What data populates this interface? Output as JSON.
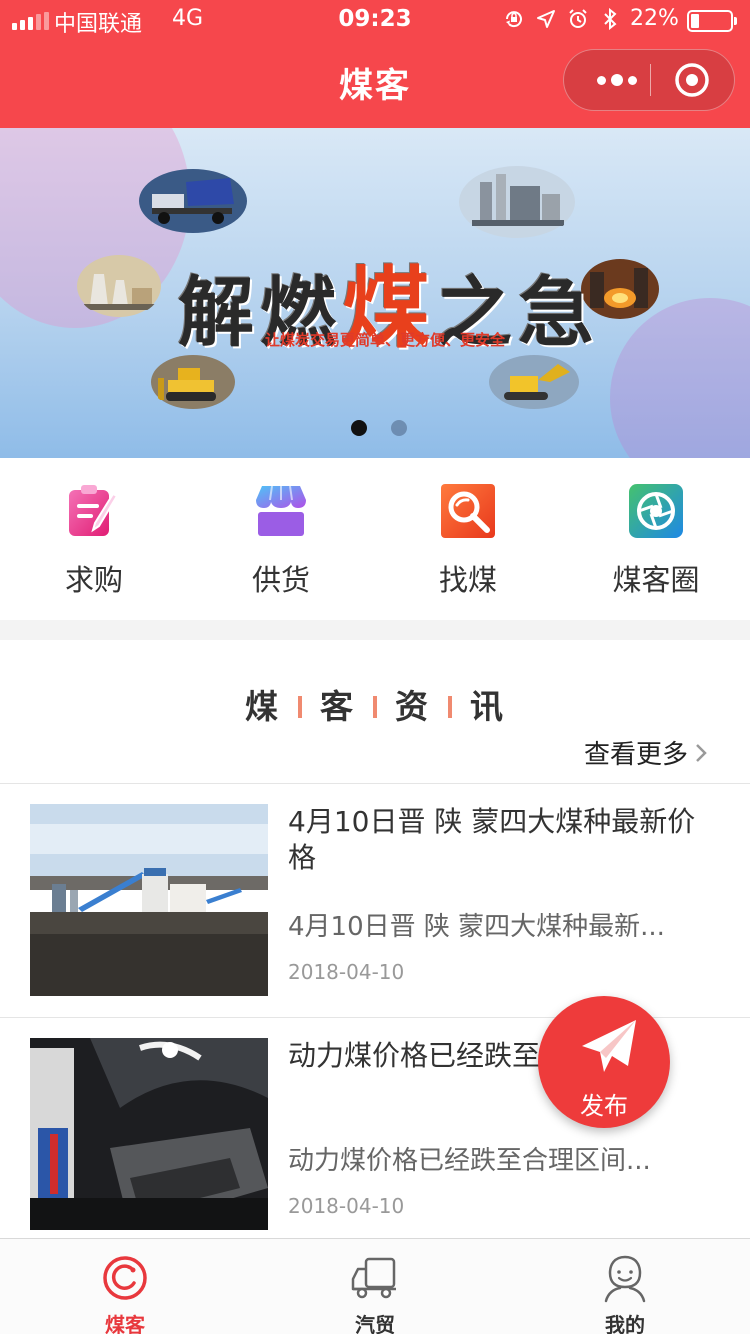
{
  "status_bar": {
    "carrier": "中国联通",
    "network": "4G",
    "time": "09:23",
    "battery_percent": "22%",
    "battery_level": 0.22,
    "icons": [
      "orientation-lock-icon",
      "location-icon",
      "alarm-icon",
      "bluetooth-icon"
    ]
  },
  "nav": {
    "title": "煤客",
    "more_icon": "more-dots-icon",
    "close_icon": "target-close-icon",
    "color": "#f6474c"
  },
  "banner": {
    "headline_part1": "解燃",
    "headline_hot": "煤",
    "headline_part2": "之急",
    "subline": "让煤炭交易更简单、更方便、更安全",
    "slides": 2,
    "active_slide": 1
  },
  "quick_menu": [
    {
      "label": "求购",
      "icon": "purchase-request-icon"
    },
    {
      "label": "供货",
      "icon": "supply-store-icon"
    },
    {
      "label": "找煤",
      "icon": "search-coal-icon"
    },
    {
      "label": "煤客圈",
      "icon": "community-circle-icon"
    }
  ],
  "news": {
    "title_chars": [
      "煤",
      "客",
      "资",
      "讯"
    ],
    "more_label": "查看更多",
    "articles": [
      {
        "title": "4月10日晋 陕 蒙四大煤种最新价格",
        "description": "4月10日晋 陕 蒙四大煤种最新...",
        "date": "2018-04-10"
      },
      {
        "title": "动力煤价格已经跌至合理区间",
        "description": "动力煤价格已经跌至合理区间...",
        "date": "2018-04-10"
      }
    ]
  },
  "fab": {
    "label": "发布",
    "icon": "paper-plane-icon"
  },
  "tabs": [
    {
      "label": "煤客",
      "icon": "home-ring-icon",
      "active": true
    },
    {
      "label": "汽贸",
      "icon": "truck-icon",
      "active": false
    },
    {
      "label": "我的",
      "icon": "person-icon",
      "active": false
    }
  ],
  "colors": {
    "accent": "#f6474c",
    "tab_active": "#e8383d",
    "fab": "#ee3b3b"
  }
}
